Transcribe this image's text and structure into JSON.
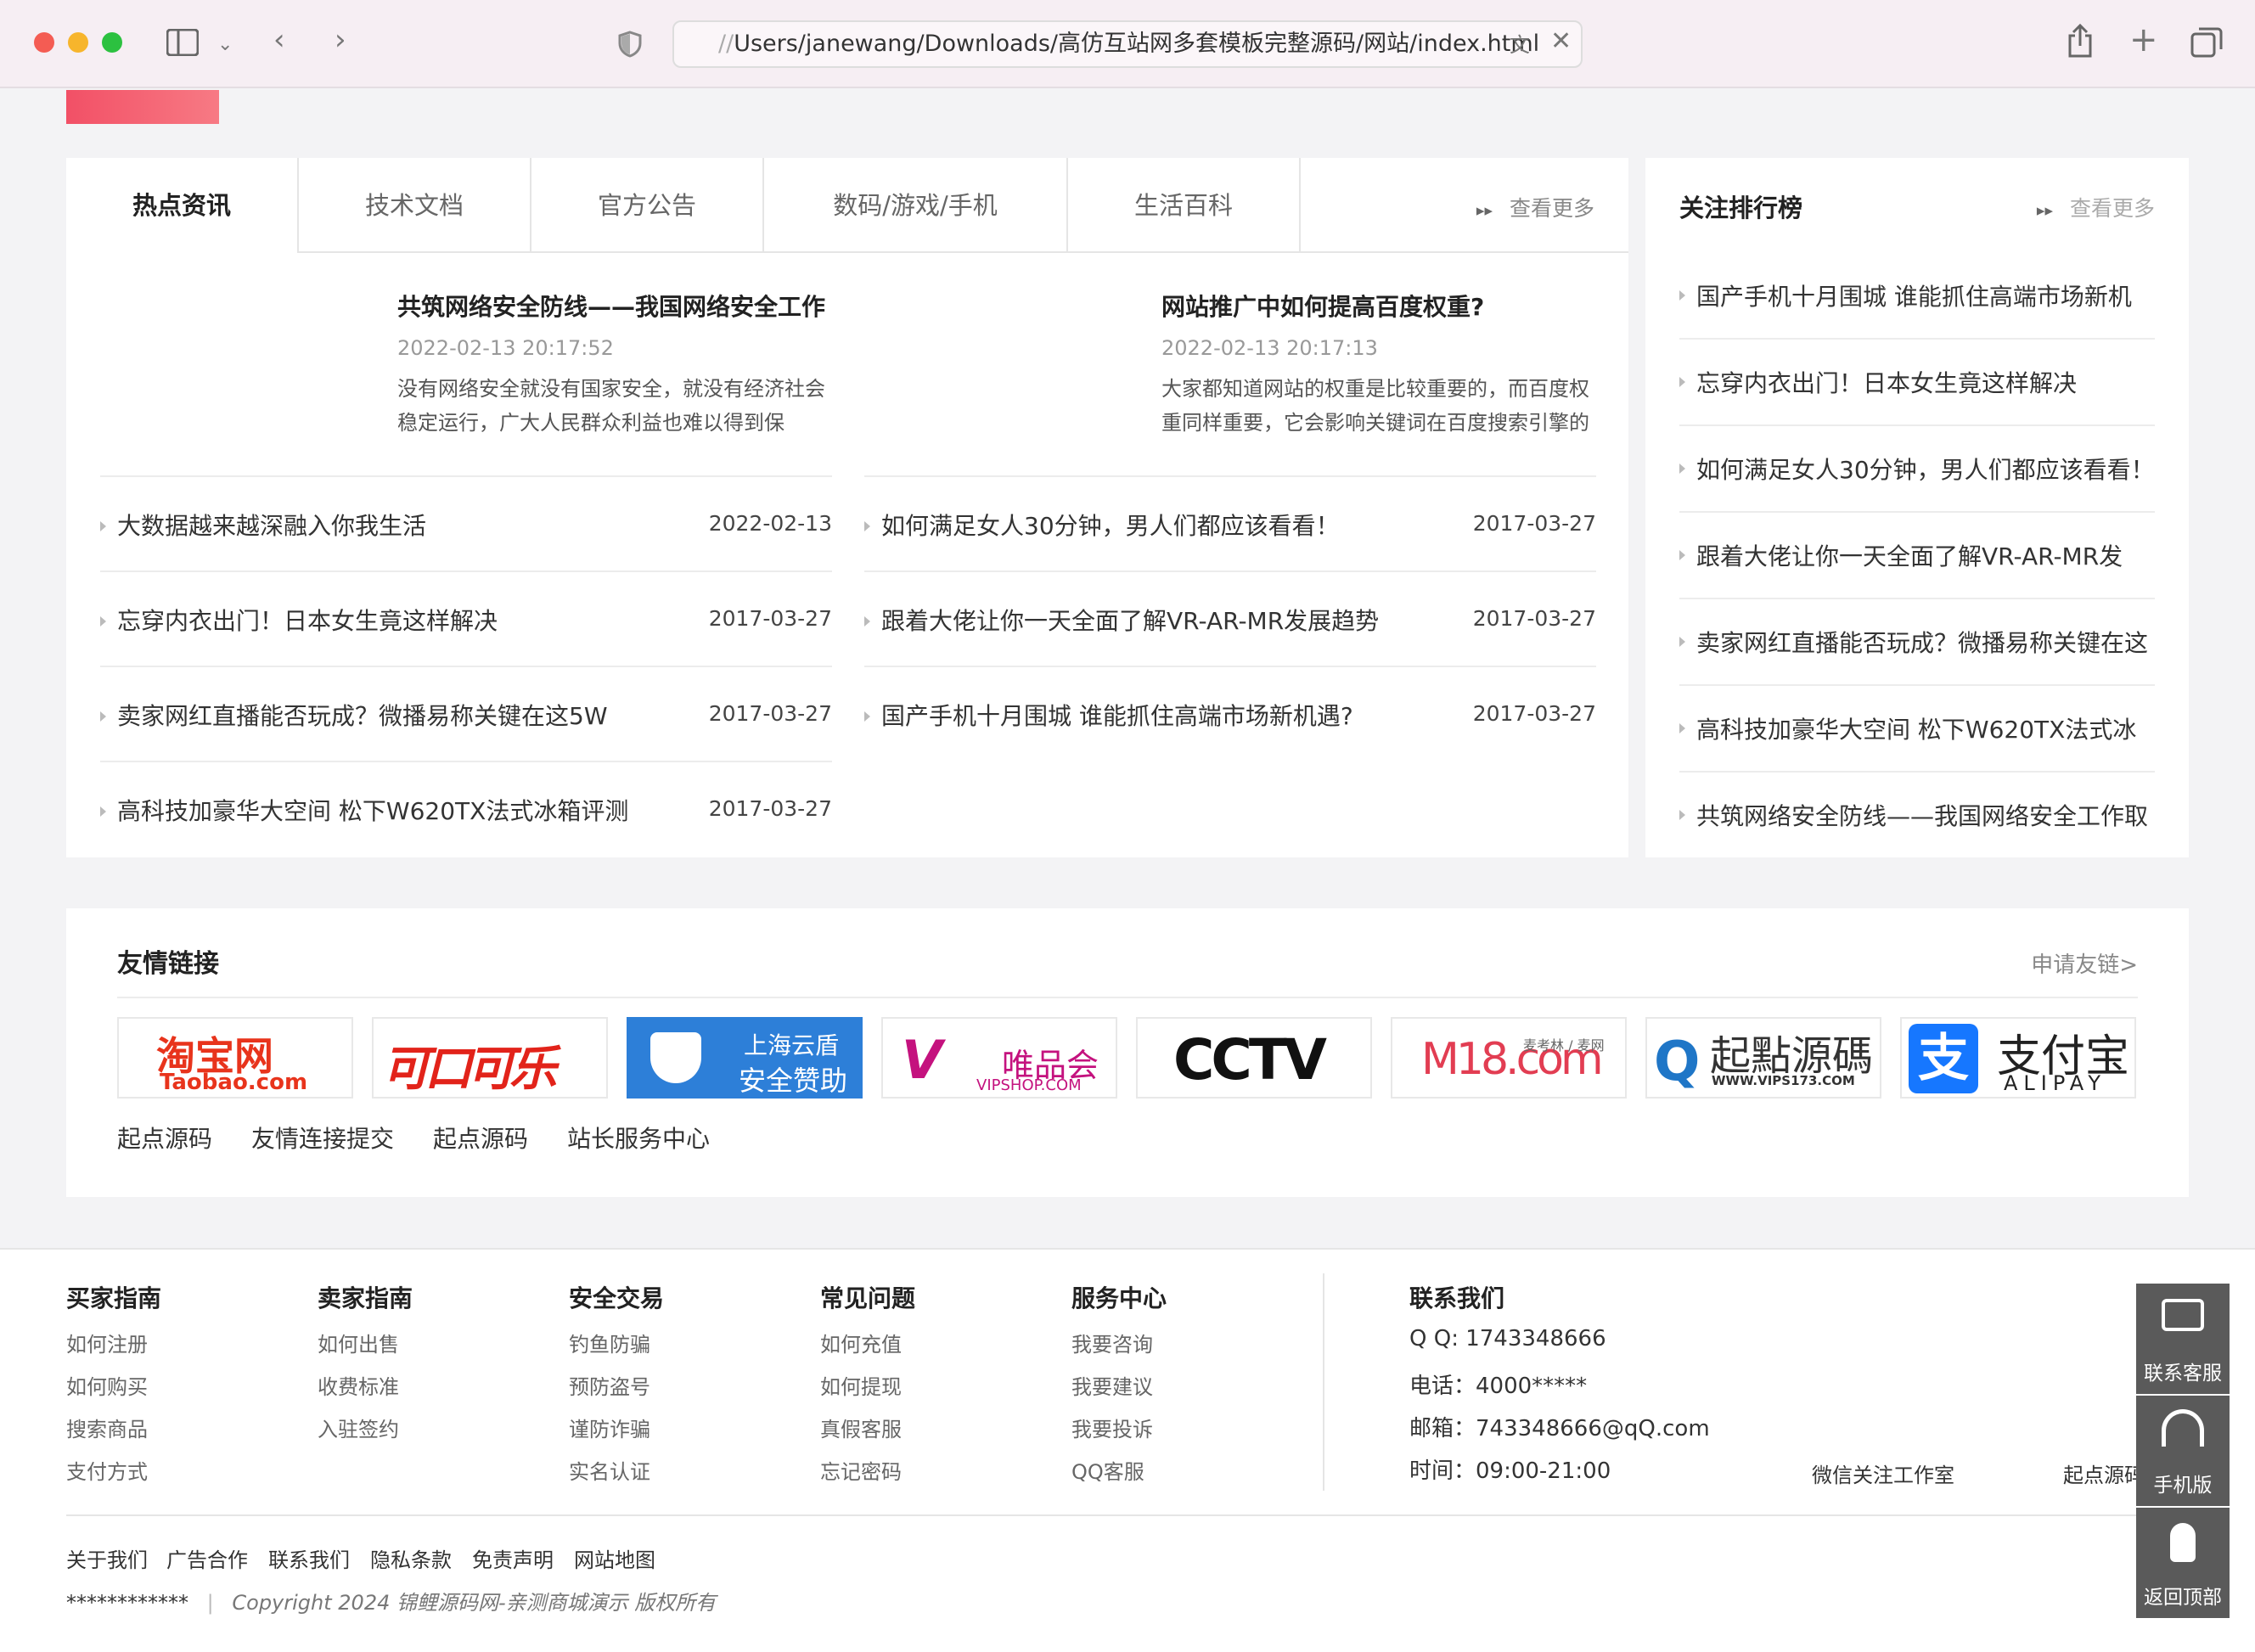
{
  "browser": {
    "url_prefix": "//",
    "url": "Users/janewang/Downloads/高仿互站网多套模板完整源码/网站/index.html"
  },
  "colors": {
    "accent_red": "#f2606e",
    "panel": "#ffffff",
    "page_bg": "#f3f3f5"
  },
  "news": {
    "tabs": [
      "热点资讯",
      "技术文档",
      "官方公告",
      "数码/游戏/手机",
      "生活百科"
    ],
    "more": "查看更多",
    "featured": [
      {
        "title": "共筑网络安全防线——我国网络安全工作",
        "date": "2022-02-13 20:17:52",
        "desc": "没有网络安全就没有国家安全，就没有经济社会稳定运行，广大人民群众利益也难以得到保"
      },
      {
        "title": "网站推广中如何提高百度权重?",
        "date": "2022-02-13 20:17:13",
        "desc": "大家都知道网站的权重是比较重要的，而百度权重同样重要，它会影响关键词在百度搜索引擎的"
      }
    ],
    "left_list": [
      {
        "title": "大数据越来越深融入你我生活",
        "date": "2022-02-13"
      },
      {
        "title": "忘穿内衣出门！日本女生竟这样解决",
        "date": "2017-03-27"
      },
      {
        "title": "卖家网红直播能否玩成？微播易称关键在这5W",
        "date": "2017-03-27"
      },
      {
        "title": "高科技加豪华大空间 松下W620TX法式冰箱评测",
        "date": "2017-03-27"
      }
    ],
    "right_list": [
      {
        "title": "如何满足女人30分钟，男人们都应该看看！",
        "date": "2017-03-27"
      },
      {
        "title": "跟着大佬让你一天全面了解VR-AR-MR发展趋势",
        "date": "2017-03-27"
      },
      {
        "title": "国产手机十月围城 谁能抓住高端市场新机遇?",
        "date": "2017-03-27"
      }
    ]
  },
  "ranking": {
    "title": "关注排行榜",
    "more": "查看更多",
    "items": [
      "国产手机十月围城 谁能抓住高端市场新机",
      "忘穿内衣出门！日本女生竟这样解决",
      "如何满足女人30分钟，男人们都应该看看！",
      "跟着大佬让你一天全面了解VR-AR-MR发",
      "卖家网红直播能否玩成？微播易称关键在这",
      "高科技加豪华大空间 松下W620TX法式冰",
      "共筑网络安全防线——我国网络安全工作取"
    ]
  },
  "friends": {
    "title": "友情链接",
    "apply": "申请友链>",
    "logos": [
      {
        "main": "淘宝网",
        "sub": "Taobao.com"
      },
      {
        "main": "可口可乐",
        "sub": ""
      },
      {
        "main": "上海云盾",
        "sub": "安全赞助"
      },
      {
        "main": "唯品会",
        "sub": "VIPSHOP.COM"
      },
      {
        "main": "CCTV",
        "sub": ""
      },
      {
        "main": "M18.com",
        "sub": "麦考林 / 麦网"
      },
      {
        "main": "起點源碼",
        "sub": "WWW.VIPS173.COM"
      },
      {
        "main": "支付宝",
        "sub": "ALIPAY"
      }
    ],
    "text_links": [
      "起点源码",
      "友情连接提交",
      "起点源码",
      "站长服务中心"
    ]
  },
  "footer": {
    "columns": [
      {
        "title": "买家指南",
        "items": [
          "如何注册",
          "如何购买",
          "搜索商品",
          "支付方式"
        ]
      },
      {
        "title": "卖家指南",
        "items": [
          "如何出售",
          "收费标准",
          "入驻签约"
        ]
      },
      {
        "title": "安全交易",
        "items": [
          "钓鱼防骗",
          "预防盗号",
          "谨防诈骗",
          "实名认证"
        ]
      },
      {
        "title": "常见问题",
        "items": [
          "如何充值",
          "如何提现",
          "真假客服",
          "忘记密码"
        ]
      },
      {
        "title": "服务中心",
        "items": [
          "我要咨询",
          "我要建议",
          "我要投诉",
          "QQ客服"
        ]
      }
    ],
    "contact": {
      "title": "联系我们",
      "qq": "Q Q: 1743348666",
      "phone": "电话：4000*****",
      "email": "邮箱：743348666@qQ.com",
      "hours": "时间：09:00-21:00"
    },
    "qr_labels": [
      "微信关注工作室",
      "起点源码"
    ],
    "bottom_links": [
      "关于我们",
      "广告合作",
      "联系我们",
      "隐私条款",
      "免责声明",
      "网站地图"
    ],
    "icp": "************",
    "copyright": "Copyright 2024 锦鲤源码网-亲测商城演示 版权所有"
  },
  "sidebar": {
    "service": "联系客服",
    "mobile": "手机版",
    "top": "返回顶部"
  }
}
